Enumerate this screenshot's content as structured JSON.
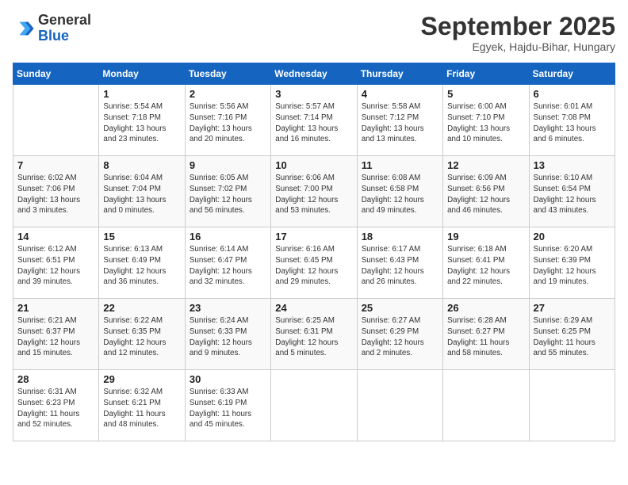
{
  "header": {
    "logo_line1": "General",
    "logo_line2": "Blue",
    "month_title": "September 2025",
    "subtitle": "Egyek, Hajdu-Bihar, Hungary"
  },
  "days_of_week": [
    "Sunday",
    "Monday",
    "Tuesday",
    "Wednesday",
    "Thursday",
    "Friday",
    "Saturday"
  ],
  "weeks": [
    [
      {
        "day": "",
        "info": ""
      },
      {
        "day": "1",
        "info": "Sunrise: 5:54 AM\nSunset: 7:18 PM\nDaylight: 13 hours\nand 23 minutes."
      },
      {
        "day": "2",
        "info": "Sunrise: 5:56 AM\nSunset: 7:16 PM\nDaylight: 13 hours\nand 20 minutes."
      },
      {
        "day": "3",
        "info": "Sunrise: 5:57 AM\nSunset: 7:14 PM\nDaylight: 13 hours\nand 16 minutes."
      },
      {
        "day": "4",
        "info": "Sunrise: 5:58 AM\nSunset: 7:12 PM\nDaylight: 13 hours\nand 13 minutes."
      },
      {
        "day": "5",
        "info": "Sunrise: 6:00 AM\nSunset: 7:10 PM\nDaylight: 13 hours\nand 10 minutes."
      },
      {
        "day": "6",
        "info": "Sunrise: 6:01 AM\nSunset: 7:08 PM\nDaylight: 13 hours\nand 6 minutes."
      }
    ],
    [
      {
        "day": "7",
        "info": "Sunrise: 6:02 AM\nSunset: 7:06 PM\nDaylight: 13 hours\nand 3 minutes."
      },
      {
        "day": "8",
        "info": "Sunrise: 6:04 AM\nSunset: 7:04 PM\nDaylight: 13 hours\nand 0 minutes."
      },
      {
        "day": "9",
        "info": "Sunrise: 6:05 AM\nSunset: 7:02 PM\nDaylight: 12 hours\nand 56 minutes."
      },
      {
        "day": "10",
        "info": "Sunrise: 6:06 AM\nSunset: 7:00 PM\nDaylight: 12 hours\nand 53 minutes."
      },
      {
        "day": "11",
        "info": "Sunrise: 6:08 AM\nSunset: 6:58 PM\nDaylight: 12 hours\nand 49 minutes."
      },
      {
        "day": "12",
        "info": "Sunrise: 6:09 AM\nSunset: 6:56 PM\nDaylight: 12 hours\nand 46 minutes."
      },
      {
        "day": "13",
        "info": "Sunrise: 6:10 AM\nSunset: 6:54 PM\nDaylight: 12 hours\nand 43 minutes."
      }
    ],
    [
      {
        "day": "14",
        "info": "Sunrise: 6:12 AM\nSunset: 6:51 PM\nDaylight: 12 hours\nand 39 minutes."
      },
      {
        "day": "15",
        "info": "Sunrise: 6:13 AM\nSunset: 6:49 PM\nDaylight: 12 hours\nand 36 minutes."
      },
      {
        "day": "16",
        "info": "Sunrise: 6:14 AM\nSunset: 6:47 PM\nDaylight: 12 hours\nand 32 minutes."
      },
      {
        "day": "17",
        "info": "Sunrise: 6:16 AM\nSunset: 6:45 PM\nDaylight: 12 hours\nand 29 minutes."
      },
      {
        "day": "18",
        "info": "Sunrise: 6:17 AM\nSunset: 6:43 PM\nDaylight: 12 hours\nand 26 minutes."
      },
      {
        "day": "19",
        "info": "Sunrise: 6:18 AM\nSunset: 6:41 PM\nDaylight: 12 hours\nand 22 minutes."
      },
      {
        "day": "20",
        "info": "Sunrise: 6:20 AM\nSunset: 6:39 PM\nDaylight: 12 hours\nand 19 minutes."
      }
    ],
    [
      {
        "day": "21",
        "info": "Sunrise: 6:21 AM\nSunset: 6:37 PM\nDaylight: 12 hours\nand 15 minutes."
      },
      {
        "day": "22",
        "info": "Sunrise: 6:22 AM\nSunset: 6:35 PM\nDaylight: 12 hours\nand 12 minutes."
      },
      {
        "day": "23",
        "info": "Sunrise: 6:24 AM\nSunset: 6:33 PM\nDaylight: 12 hours\nand 9 minutes."
      },
      {
        "day": "24",
        "info": "Sunrise: 6:25 AM\nSunset: 6:31 PM\nDaylight: 12 hours\nand 5 minutes."
      },
      {
        "day": "25",
        "info": "Sunrise: 6:27 AM\nSunset: 6:29 PM\nDaylight: 12 hours\nand 2 minutes."
      },
      {
        "day": "26",
        "info": "Sunrise: 6:28 AM\nSunset: 6:27 PM\nDaylight: 11 hours\nand 58 minutes."
      },
      {
        "day": "27",
        "info": "Sunrise: 6:29 AM\nSunset: 6:25 PM\nDaylight: 11 hours\nand 55 minutes."
      }
    ],
    [
      {
        "day": "28",
        "info": "Sunrise: 6:31 AM\nSunset: 6:23 PM\nDaylight: 11 hours\nand 52 minutes."
      },
      {
        "day": "29",
        "info": "Sunrise: 6:32 AM\nSunset: 6:21 PM\nDaylight: 11 hours\nand 48 minutes."
      },
      {
        "day": "30",
        "info": "Sunrise: 6:33 AM\nSunset: 6:19 PM\nDaylight: 11 hours\nand 45 minutes."
      },
      {
        "day": "",
        "info": ""
      },
      {
        "day": "",
        "info": ""
      },
      {
        "day": "",
        "info": ""
      },
      {
        "day": "",
        "info": ""
      }
    ]
  ]
}
